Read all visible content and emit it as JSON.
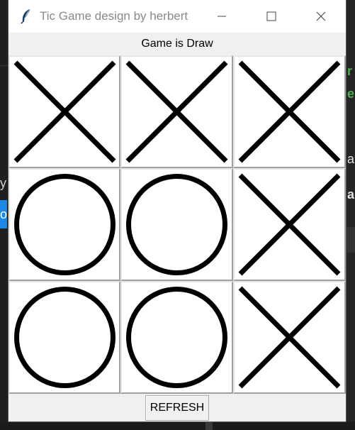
{
  "window": {
    "title": "Tic Game design by herbert",
    "app_icon": "feather-icon",
    "controls": [
      "minimize-icon",
      "maximize-icon",
      "close-icon"
    ]
  },
  "status": {
    "text": "Game is Draw"
  },
  "board": {
    "cells": [
      "X",
      "X",
      "X",
      "O",
      "O",
      "X",
      "O",
      "O",
      "X"
    ]
  },
  "actions": {
    "refresh_label": "REFRESH"
  },
  "background": {
    "left_fragments": [
      "y",
      "o"
    ],
    "right_fragments": [
      "r",
      "e",
      "a",
      "a"
    ],
    "right_colors": {
      "r": "#4caf50",
      "e": "#4caf50",
      "a": "#e0e0e0"
    }
  },
  "colors": {
    "mark": "#000000",
    "title_text": "#8a8a8a",
    "window_bg": "#f0f0f0"
  }
}
